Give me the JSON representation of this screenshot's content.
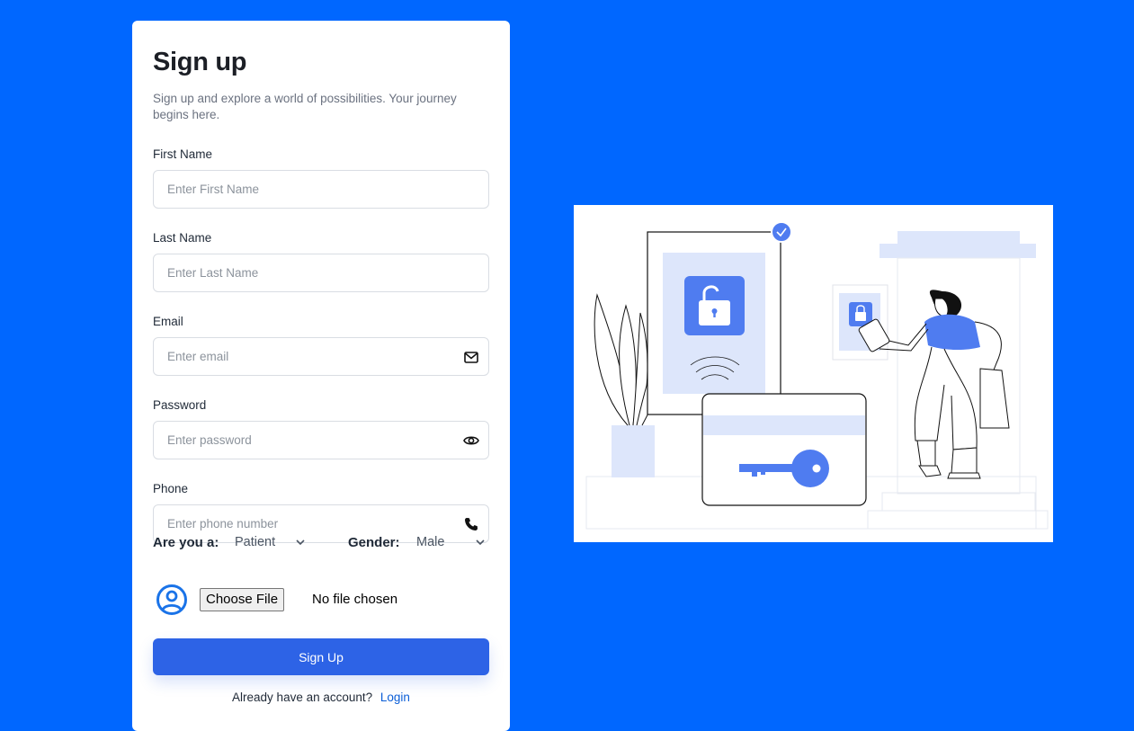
{
  "form": {
    "title": "Sign up",
    "subtitle": "Sign up and explore a world of possibilities. Your journey begins here.",
    "fields": [
      {
        "label": "First Name",
        "placeholder": "Enter First Name",
        "value": ""
      },
      {
        "label": "Last Name",
        "placeholder": "Enter Last Name",
        "value": ""
      },
      {
        "label": "Email",
        "placeholder": "Enter email",
        "value": "",
        "icon": "envelope-icon"
      },
      {
        "label": "Password",
        "placeholder": "Enter password",
        "value": "",
        "icon": "eye-icon"
      },
      {
        "label": "Phone",
        "placeholder": "Enter phone number",
        "value": "",
        "icon": "phone-icon"
      }
    ],
    "role": {
      "label": "Are you a:",
      "selected": "Patient"
    },
    "gender": {
      "label": "Gender:",
      "selected": "Male"
    },
    "file": {
      "button_label": "Choose File",
      "status": "No file chosen",
      "icon": "user-avatar-icon"
    },
    "submit_label": "Sign Up",
    "login_prompt": "Already have an account?",
    "login_link": "Login"
  },
  "colors": {
    "background": "#0067ff",
    "primary_button": "#2d63e6",
    "link": "#0b5ed7",
    "illustration_accent": "#4f7cf0",
    "illustration_light": "#dde6fb"
  },
  "illustration": {
    "name": "unlock-key-illustration"
  }
}
